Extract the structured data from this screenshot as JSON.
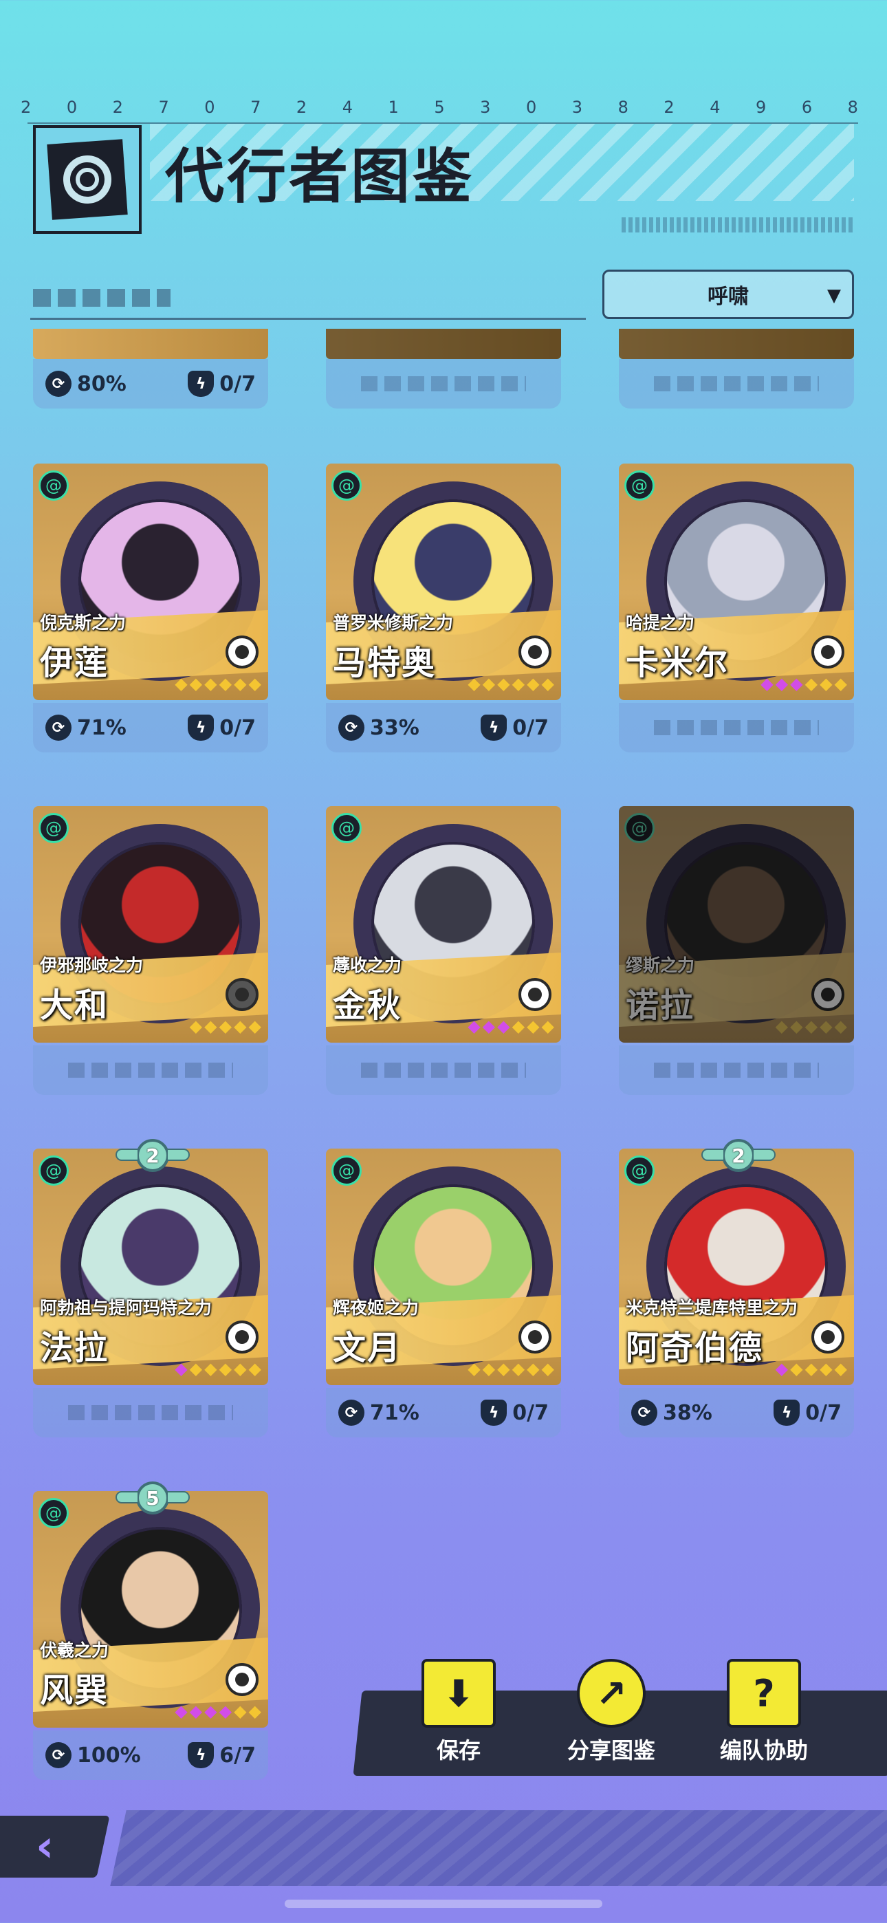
{
  "header": {
    "digits": [
      "2",
      "0",
      "2",
      "7",
      "0",
      "7",
      "2",
      "4",
      "1",
      "5",
      "3",
      "0",
      "3",
      "8",
      "2",
      "4",
      "9",
      "6",
      "8"
    ],
    "title": "代行者图鉴",
    "filter_label": "呼啸",
    "filter_arrow": "▼"
  },
  "top_partial": [
    {
      "stat_rate": "80%",
      "stat_count": "0/7"
    },
    {
      "stat_rate": "",
      "stat_count": ""
    },
    {
      "stat_rate": "",
      "stat_count": ""
    }
  ],
  "cards": [
    {
      "power": "倪克斯之力",
      "name": "伊莲",
      "stars_purple": 0,
      "stars_gold": 6,
      "rate": "71%",
      "count": "0/7",
      "badge": "",
      "dim": false
    },
    {
      "power": "普罗米修斯之力",
      "name": "马特奥",
      "stars_purple": 0,
      "stars_gold": 6,
      "rate": "33%",
      "count": "0/7",
      "badge": "",
      "dim": false
    },
    {
      "power": "哈提之力",
      "name": "卡米尔",
      "stars_purple": 3,
      "stars_gold": 3,
      "rate": "",
      "count": "",
      "badge": "",
      "dim": false
    },
    {
      "power": "伊邪那岐之力",
      "name": "大和",
      "stars_purple": 0,
      "stars_gold": 5,
      "rate": "",
      "count": "",
      "badge": "",
      "dim": false
    },
    {
      "power": "蓐收之力",
      "name": "金秋",
      "stars_purple": 3,
      "stars_gold": 3,
      "rate": "",
      "count": "",
      "badge": "",
      "dim": false
    },
    {
      "power": "缪斯之力",
      "name": "诺拉",
      "stars_purple": 0,
      "stars_gold": 5,
      "rate": "",
      "count": "",
      "badge": "",
      "dim": true
    },
    {
      "power": "阿勃祖与提阿玛特之力",
      "name": "法拉",
      "stars_purple": 1,
      "stars_gold": 5,
      "rate": "",
      "count": "",
      "badge": "2",
      "dim": false
    },
    {
      "power": "辉夜姬之力",
      "name": "文月",
      "stars_purple": 0,
      "stars_gold": 6,
      "rate": "71%",
      "count": "0/7",
      "badge": "",
      "dim": false
    },
    {
      "power": "米克特兰堤库特里之力",
      "name": "阿奇伯德",
      "stars_purple": 1,
      "stars_gold": 4,
      "rate": "38%",
      "count": "0/7",
      "badge": "2",
      "dim": false
    },
    {
      "power": "伏羲之力",
      "name": "风巽",
      "stars_purple": 4,
      "stars_gold": 2,
      "rate": "100%",
      "count": "6/7",
      "badge": "5",
      "dim": false
    }
  ],
  "actions": {
    "save": "保存",
    "share": "分享图鉴",
    "team": "编队协助"
  },
  "colors": {
    "accent_gold": "#f4c531",
    "accent_purple": "#d24de8",
    "element_green": "#38e0a8",
    "action_yellow": "#f3ea34"
  },
  "icons": {
    "element": "wind-spiral-icon",
    "wheel": "wheel-icon",
    "rate": "progress-ring-icon",
    "count": "shield-bolt-icon",
    "back": "chevron-left-icon"
  }
}
